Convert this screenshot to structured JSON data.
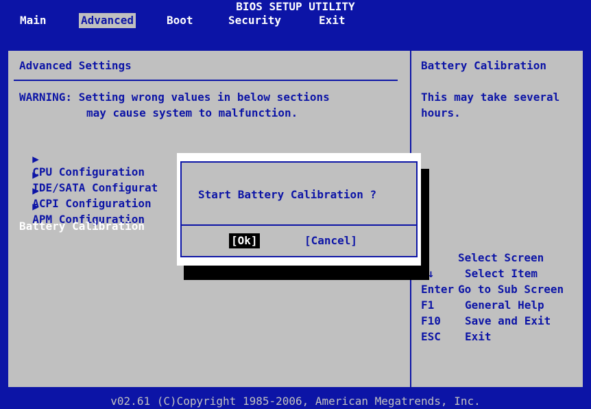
{
  "title": "BIOS SETUP UTILITY",
  "menu": [
    {
      "label": "Main"
    },
    {
      "label": "Advanced"
    },
    {
      "label": "Boot"
    },
    {
      "label": "Security"
    },
    {
      "label": "Exit"
    }
  ],
  "left": {
    "heading": "Advanced Settings",
    "warning_line1": "WARNING: Setting wrong values in below sections",
    "warning_line2": "may cause system to malfunction.",
    "items": [
      {
        "arrow": "▶",
        "label": "CPU Configuration"
      },
      {
        "arrow": "▶",
        "label": "IDE/SATA Configurat"
      },
      {
        "arrow": "▶",
        "label": "ACPI Configuration"
      },
      {
        "arrow": "▶",
        "label": "APM Configuration"
      }
    ],
    "battery_item": "Battery Calibration"
  },
  "dialog": {
    "question": "Start Battery Calibration ?",
    "ok_label": "[Ok]",
    "cancel_label": "[Cancel]"
  },
  "help": {
    "title": "Battery Calibration",
    "desc_line1": "This may take several",
    "desc_line2": "hours.",
    "keys": [
      {
        "key": "←",
        "desc": "Select Screen"
      },
      {
        "key": "↑↓",
        "desc": "Select Item"
      },
      {
        "key": "Enter",
        "desc": "Go to Sub Screen"
      },
      {
        "key": "F1",
        "desc": "General Help"
      },
      {
        "key": "F10",
        "desc": "Save and Exit"
      },
      {
        "key": "ESC",
        "desc": "Exit"
      }
    ]
  },
  "footer": "v02.61 (C)Copyright 1985-2006, American Megatrends, Inc.",
  "colors": {
    "bios_blue": "#0c14a6",
    "panel_gray": "#c0c0c0",
    "white": "#ffffff",
    "highlight": "#000000"
  }
}
